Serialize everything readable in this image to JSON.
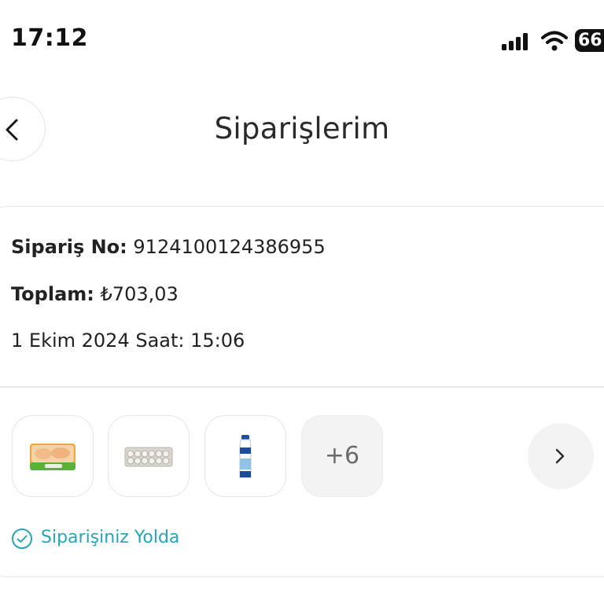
{
  "status_bar": {
    "time": "17:12",
    "battery": "66"
  },
  "header": {
    "title": "Siparişlerim",
    "back_icon": "chevron-left-icon"
  },
  "order": {
    "order_no_label": "Sipariş No:",
    "order_no_value": "9124100124386955",
    "total_label": "Toplam:",
    "total_value": "₺703,03",
    "date_text": "1 Ekim 2024 Saat: 15:06",
    "products": [
      {
        "icon": "chicken-pack-icon"
      },
      {
        "icon": "egg-carton-icon"
      },
      {
        "icon": "milk-bottle-icon"
      }
    ],
    "more_count": "+6",
    "next_icon": "chevron-right-icon",
    "status_icon": "check-circle-icon",
    "status_text": "Siparişiniz Yolda"
  },
  "colors": {
    "accent": "#27a5b5",
    "border": "#e6e6e6",
    "text": "#222222"
  }
}
